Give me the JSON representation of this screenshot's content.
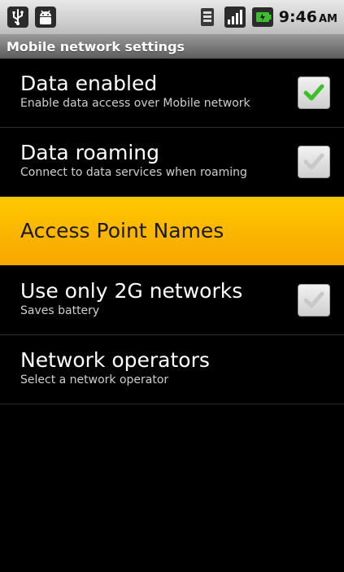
{
  "status_bar": {
    "time": "9:46",
    "ampm": "AM",
    "icons": [
      "usb-icon",
      "android-debug-icon",
      "data-transfer-icon",
      "signal-icon",
      "battery-icon"
    ]
  },
  "title_bar": {
    "title": "Mobile network settings"
  },
  "settings": {
    "data_enabled": {
      "title": "Data enabled",
      "summary": "Enable data access over Mobile network",
      "checked": true
    },
    "data_roaming": {
      "title": "Data roaming",
      "summary": "Connect to data services when roaming",
      "checked": false
    },
    "apn": {
      "title": "Access Point Names"
    },
    "only_2g": {
      "title": "Use only 2G networks",
      "summary": "Saves battery",
      "checked": false
    },
    "network_operators": {
      "title": "Network operators",
      "summary": "Select a network operator"
    }
  },
  "colors": {
    "highlight": "#f7b500",
    "check_on": "#3cbf2a",
    "check_off": "#c8c8c8"
  }
}
